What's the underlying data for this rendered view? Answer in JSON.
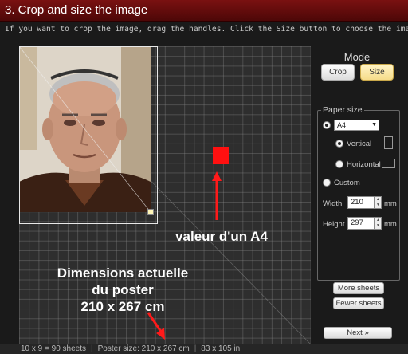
{
  "header": {
    "title": "3. Crop and size the image"
  },
  "instructions": "If you want to crop the image, drag the handles. Click the Size button to choose the image output size.",
  "mode": {
    "label": "Mode",
    "crop_label": "Crop",
    "size_label": "Size",
    "active": "Size"
  },
  "paper": {
    "legend": "Paper size",
    "format_selected": "A4",
    "vertical_label": "Vertical",
    "horizontal_label": "Horizontal",
    "orientation_selected": "Vertical",
    "custom_label": "Custom",
    "width_label": "Width",
    "width_value": "210",
    "height_label": "Height",
    "height_value": "297",
    "unit": "mm"
  },
  "buttons": {
    "more_sheets": "More sheets",
    "fewer_sheets": "Fewer sheets",
    "next": "Next »"
  },
  "annotations": {
    "a4_value": "valeur d'un A4",
    "dimensions_line1": "Dimensions actuelle",
    "dimensions_line2": "du poster",
    "dimensions_line3": "210 x 267 cm"
  },
  "status": {
    "sheets": "10 x 9 = 90 sheets",
    "poster_size": "Poster size: 210 x 267 cm",
    "inches": "83 x 105 in"
  },
  "colors": {
    "header_bg": "#6b0e0e",
    "paper_marker": "#ff1010",
    "annotation_arrow": "#ff1a1a",
    "size_button_active": "#f6dc8a"
  }
}
